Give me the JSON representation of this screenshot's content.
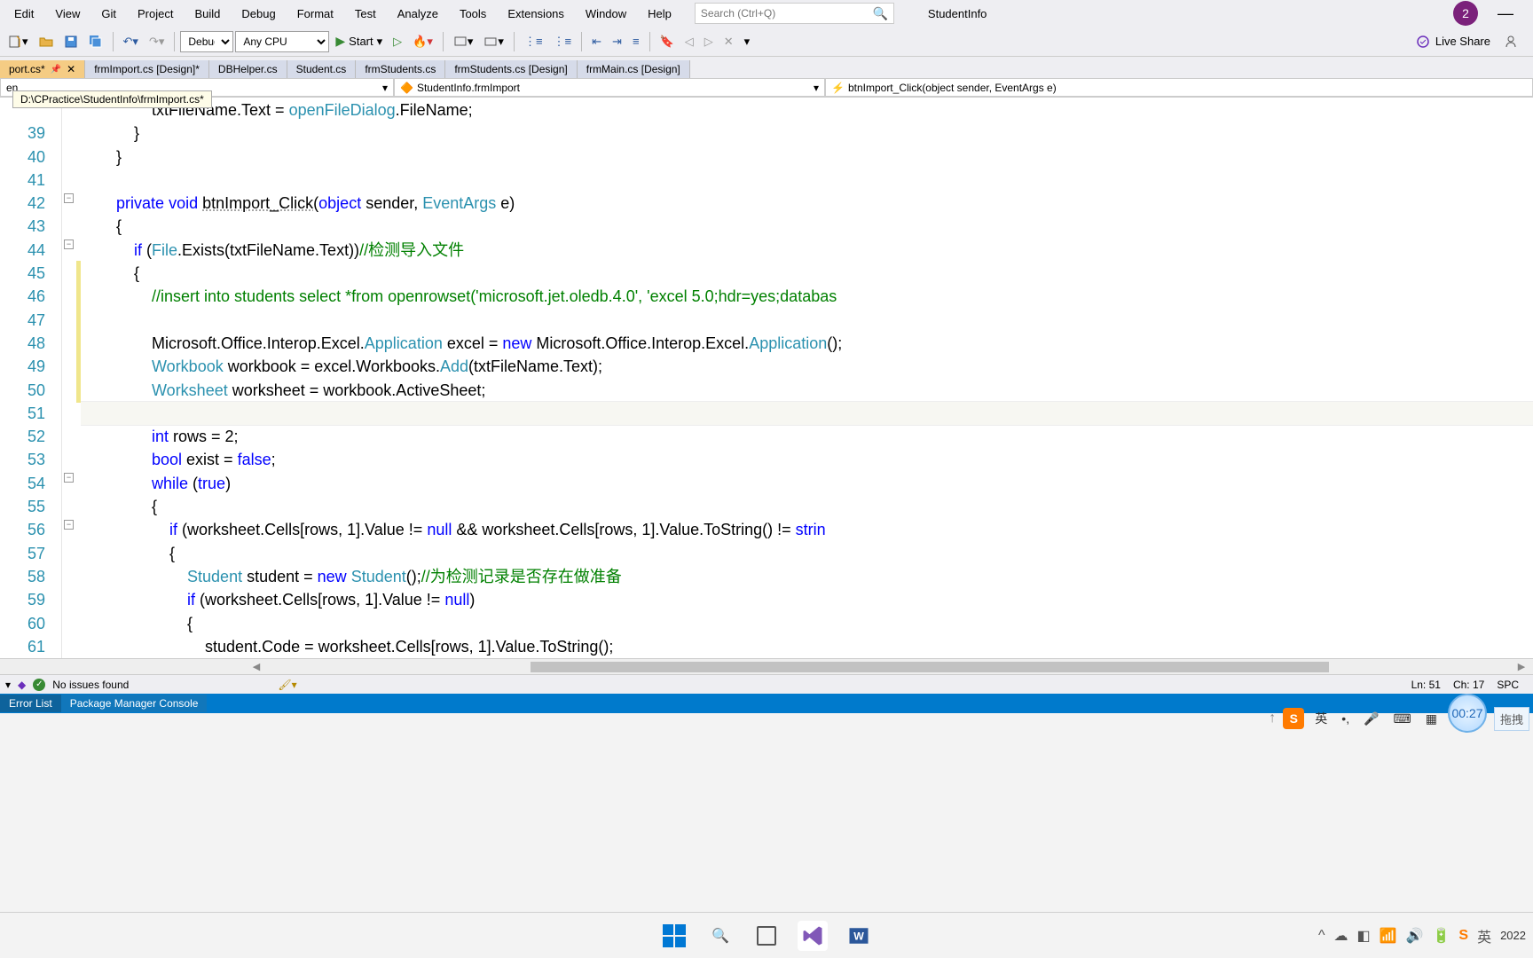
{
  "menu": {
    "items": [
      "Edit",
      "View",
      "Git",
      "Project",
      "Build",
      "Debug",
      "Format",
      "Test",
      "Analyze",
      "Tools",
      "Extensions",
      "Window",
      "Help"
    ],
    "search_placeholder": "Search (Ctrl+Q)",
    "solution": "StudentInfo",
    "avatar": "2"
  },
  "toolbar": {
    "config": "Debug",
    "platform": "Any CPU",
    "start_label": "Start",
    "liveshare": "Live Share"
  },
  "tabs": [
    {
      "label": "port.cs*",
      "active": true,
      "pinned": true,
      "close": true
    },
    {
      "label": "frmImport.cs [Design]*"
    },
    {
      "label": "DBHelper.cs"
    },
    {
      "label": "Student.cs"
    },
    {
      "label": "frmStudents.cs"
    },
    {
      "label": "frmStudents.cs [Design]"
    },
    {
      "label": "frmMain.cs [Design]"
    }
  ],
  "tooltip_path": "D:\\CPractice\\StudentInfo\\frmImport.cs*",
  "nav": {
    "project_hint": "en",
    "class": "StudentInfo.frmImport",
    "method": "btnImport_Click(object sender, EventArgs e)"
  },
  "code_lines": [
    {
      "n": "",
      "html": "                txtFileName.Text = <span class='type'>openFileDialog</span>.FileName;"
    },
    {
      "n": "39",
      "html": "            }"
    },
    {
      "n": "40",
      "html": "        }"
    },
    {
      "n": "41",
      "html": ""
    },
    {
      "n": "42",
      "html": "        <span class='kw'>private</span> <span class='kw'>void</span> <span class='method-ul'>btnImport_Click</span>(<span class='kw'>object</span> sender, <span class='type'>EventArgs</span> e)"
    },
    {
      "n": "43",
      "html": "        {"
    },
    {
      "n": "44",
      "html": "            <span class='kw'>if</span> (<span class='type'>File</span>.Exists(txtFileName.Text))<span class='com'>//检测导入文件</span>"
    },
    {
      "n": "45",
      "html": "            {"
    },
    {
      "n": "46",
      "html": "                <span class='com'>//insert into students select *from openrowset('microsoft.jet.oledb.4.0', 'excel 5.0;hdr=yes;databas</span>"
    },
    {
      "n": "47",
      "html": ""
    },
    {
      "n": "48",
      "html": "                Microsoft.Office.Interop.Excel.<span class='type'>Application</span> excel = <span class='kw'>new</span> Microsoft.Office.Interop.Excel.<span class='type'>Application</span>();"
    },
    {
      "n": "49",
      "html": "                <span class='type'>Workbook</span> workbook = excel.Workbooks.<span class='type'>Add</span>(txtFileName.Text);"
    },
    {
      "n": "50",
      "html": "                <span class='type'>Worksheet</span> worksheet = workbook.ActiveSheet;"
    },
    {
      "n": "51",
      "html": "                ",
      "cursor": true
    },
    {
      "n": "52",
      "html": "                <span class='kw'>int</span> rows = 2;"
    },
    {
      "n": "53",
      "html": "                <span class='kw'>bool</span> exist = <span class='kw'>false</span>;"
    },
    {
      "n": "54",
      "html": "                <span class='kw'>while</span> (<span class='kw'>true</span>)"
    },
    {
      "n": "55",
      "html": "                {"
    },
    {
      "n": "56",
      "html": "                    <span class='kw'>if</span> (worksheet.Cells[rows, 1].Value != <span class='kw'>null</span> && worksheet.Cells[rows, 1].Value.ToString() != <span class='kw'>strin</span>"
    },
    {
      "n": "57",
      "html": "                    {"
    },
    {
      "n": "58",
      "html": "                        <span class='type'>Student</span> student = <span class='kw'>new</span> <span class='type'>Student</span>();<span class='com'>//为检测记录是否存在做准备</span>"
    },
    {
      "n": "59",
      "html": "                        <span class='kw'>if</span> (worksheet.Cells[rows, 1].Value != <span class='kw'>null</span>)"
    },
    {
      "n": "60",
      "html": "                        {"
    },
    {
      "n": "61",
      "html": "                            student.Code = worksheet.Cells[rows, 1].Value.ToString();"
    },
    {
      "n": "",
      "html": "                        }"
    }
  ],
  "status": {
    "issues": "No issues found",
    "ln": "Ln: 51",
    "ch": "Ch: 17",
    "spc": "SPC"
  },
  "panels": [
    "Error List",
    "Package Manager Console"
  ],
  "ime": {
    "lang": "英",
    "clock": "00:27",
    "drag": "拖拽"
  },
  "taskbar": {
    "year": "2022"
  }
}
